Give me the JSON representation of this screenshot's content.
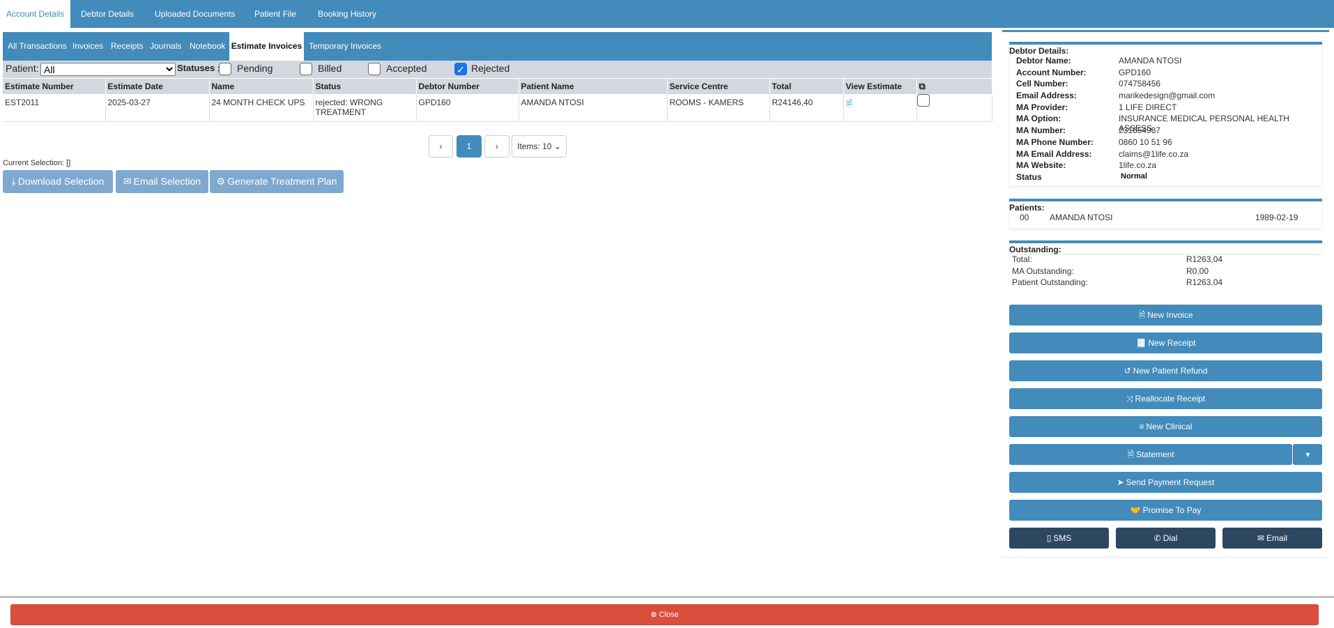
{
  "top_tabs": [
    "Account Details",
    "Debtor Details",
    "Uploaded Documents",
    "Patient File",
    "Booking History"
  ],
  "sub_tabs": [
    "All Transactions",
    "Invoices",
    "Receipts",
    "Journals",
    "Notebook",
    "Estimate Invoices",
    "Temporary Invoices"
  ],
  "filter": {
    "patient_label": "Patient:",
    "patient_value": "All",
    "statuses_label": "Statuses :",
    "statuses": [
      {
        "label": "Pending",
        "checked": false
      },
      {
        "label": "Billed",
        "checked": false
      },
      {
        "label": "Accepted",
        "checked": false
      },
      {
        "label": "Rejected",
        "checked": true
      }
    ]
  },
  "table": {
    "columns": [
      "Estimate Number",
      "Estimate Date",
      "Name",
      "Status",
      "Debtor Number",
      "Patient Name",
      "Service Centre",
      "Total",
      "View Estimate"
    ],
    "rows": [
      [
        "EST2011",
        "2025-03-27",
        "24 MONTH CHECK UPS",
        "rejected: WRONG TREATMENT",
        "GPD160",
        "AMANDA NTOSI",
        "ROOMS - KAMERS",
        "R24146,40"
      ]
    ]
  },
  "pagination": {
    "page": "1",
    "items": "Items: 10"
  },
  "current_selection": "Current Selection: []",
  "actions": {
    "download": "Download Selection",
    "email": "Email Selection",
    "generate": "Generate Treatment Plan"
  },
  "debtor": {
    "title": "Debtor Details:",
    "fields": [
      [
        "Debtor Name:",
        "AMANDA NTOSI"
      ],
      [
        "Account Number:",
        "GPD160"
      ],
      [
        "Cell Number:",
        "074758456"
      ],
      [
        "Email Address:",
        "marikedesign@gmail.com"
      ],
      [
        "MA Provider:",
        "1 LIFE DIRECT"
      ],
      [
        "MA Option:",
        "INSURANCE MEDICAL PERSONAL HEALTH ASSESS"
      ],
      [
        "MA Number:",
        "231654987"
      ],
      [
        "MA Phone Number:",
        "0860 10 51 96"
      ],
      [
        "MA Email Address:",
        "claims@1life.co.za"
      ],
      [
        "MA Website:",
        "1life.co.za"
      ],
      [
        "Status",
        "Normal"
      ]
    ]
  },
  "patients": {
    "title": "Patients:",
    "rows": [
      [
        "00",
        "AMANDA NTOSI",
        "1989-02-19"
      ]
    ]
  },
  "outstanding": {
    "title": "Outstanding:",
    "rows": [
      [
        "Total:",
        "R1263,04"
      ],
      [
        "MA Outstanding:",
        "R0,00"
      ],
      [
        "Patient Outstanding:",
        "R1263,04"
      ]
    ]
  },
  "right_buttons": [
    "New Invoice",
    "New Receipt",
    "New Patient Refund",
    "Reallocate Receipt",
    "New Clinical",
    "Statement",
    "Send Payment Request",
    "Promise To Pay"
  ],
  "contact_buttons": [
    "SMS",
    "Dial",
    "Email"
  ],
  "close": "Close",
  "colors": {
    "primary": "#428bba",
    "dark": "#2d4761",
    "danger": "#db4e3d",
    "disabled": "#7fa8cf"
  }
}
